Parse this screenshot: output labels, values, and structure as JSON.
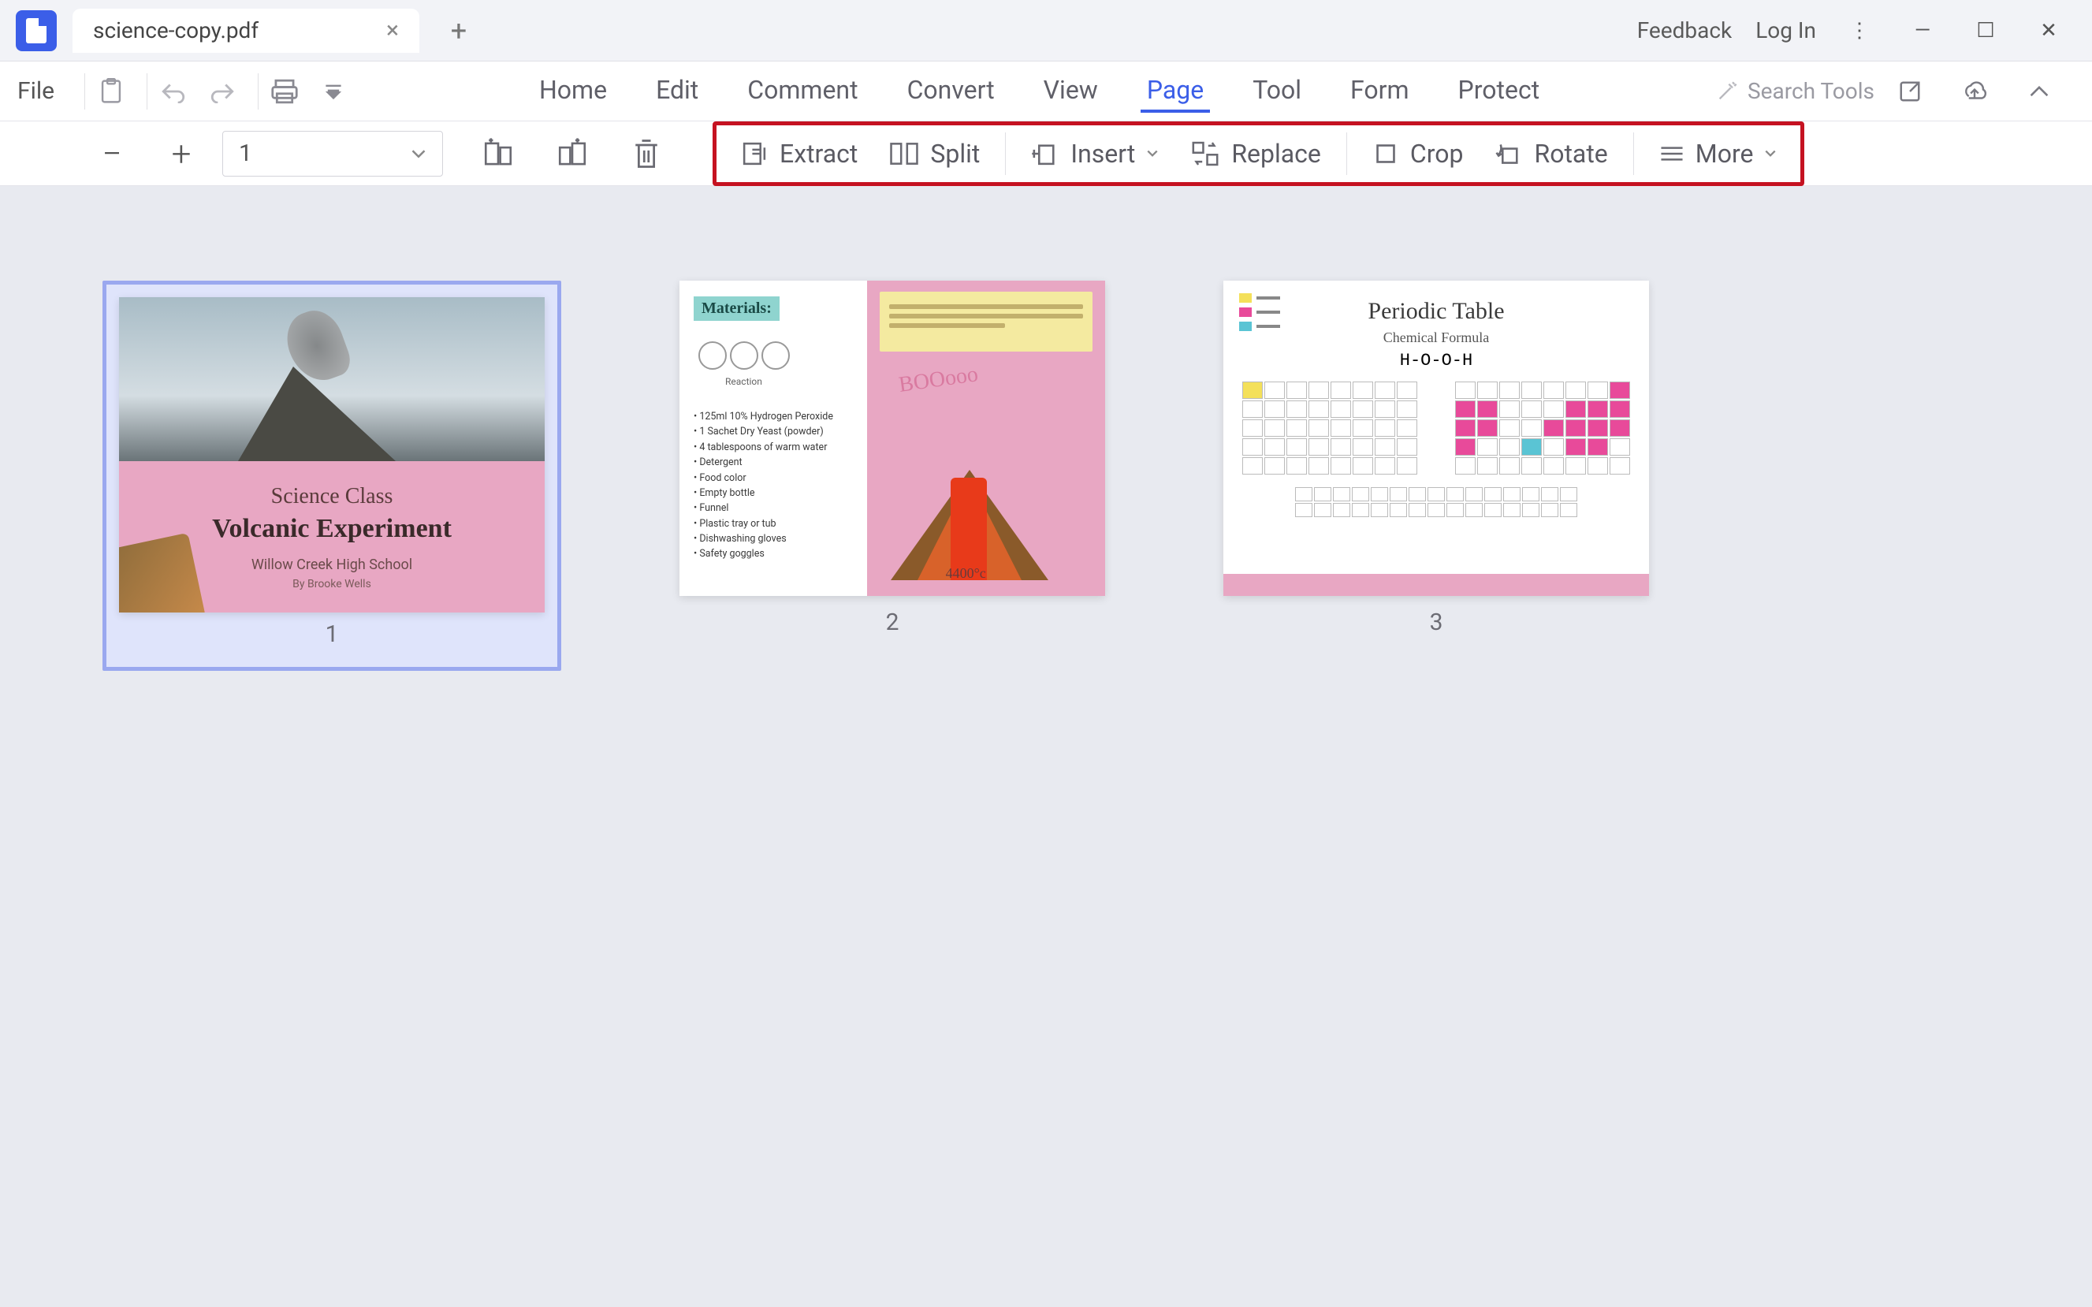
{
  "titlebar": {
    "tab_title": "science-copy.pdf",
    "feedback": "Feedback",
    "login": "Log In"
  },
  "menubar": {
    "file": "File",
    "items": [
      "Home",
      "Edit",
      "Comment",
      "Convert",
      "View",
      "Page",
      "Tool",
      "Form",
      "Protect"
    ],
    "active_index": 5,
    "search_placeholder": "Search Tools"
  },
  "toolbar": {
    "page_value": "1",
    "actions": {
      "extract": "Extract",
      "split": "Split",
      "insert": "Insert",
      "replace": "Replace",
      "crop": "Crop",
      "rotate": "Rotate",
      "more": "More"
    }
  },
  "pages": {
    "p1": {
      "number": "1",
      "title": "Science Class",
      "subtitle": "Volcanic Experiment",
      "school": "Willow Creek High School",
      "byline": "By Brooke Wells"
    },
    "p2": {
      "number": "2",
      "badge": "Materials:",
      "reaction_label": "Reaction",
      "boom": "BOOooo",
      "temp": "4400°c",
      "list": [
        "125ml 10% Hydrogen Peroxide",
        "1 Sachet Dry Yeast (powder)",
        "4 tablespoons of warm water",
        "Detergent",
        "Food color",
        "Empty bottle",
        "Funnel",
        "Plastic tray or tub",
        "Dishwashing gloves",
        "Safety goggles"
      ]
    },
    "p3": {
      "number": "3",
      "title": "Periodic Table",
      "subtitle": "Chemical Formula",
      "formula": "H-O-O-H"
    }
  }
}
